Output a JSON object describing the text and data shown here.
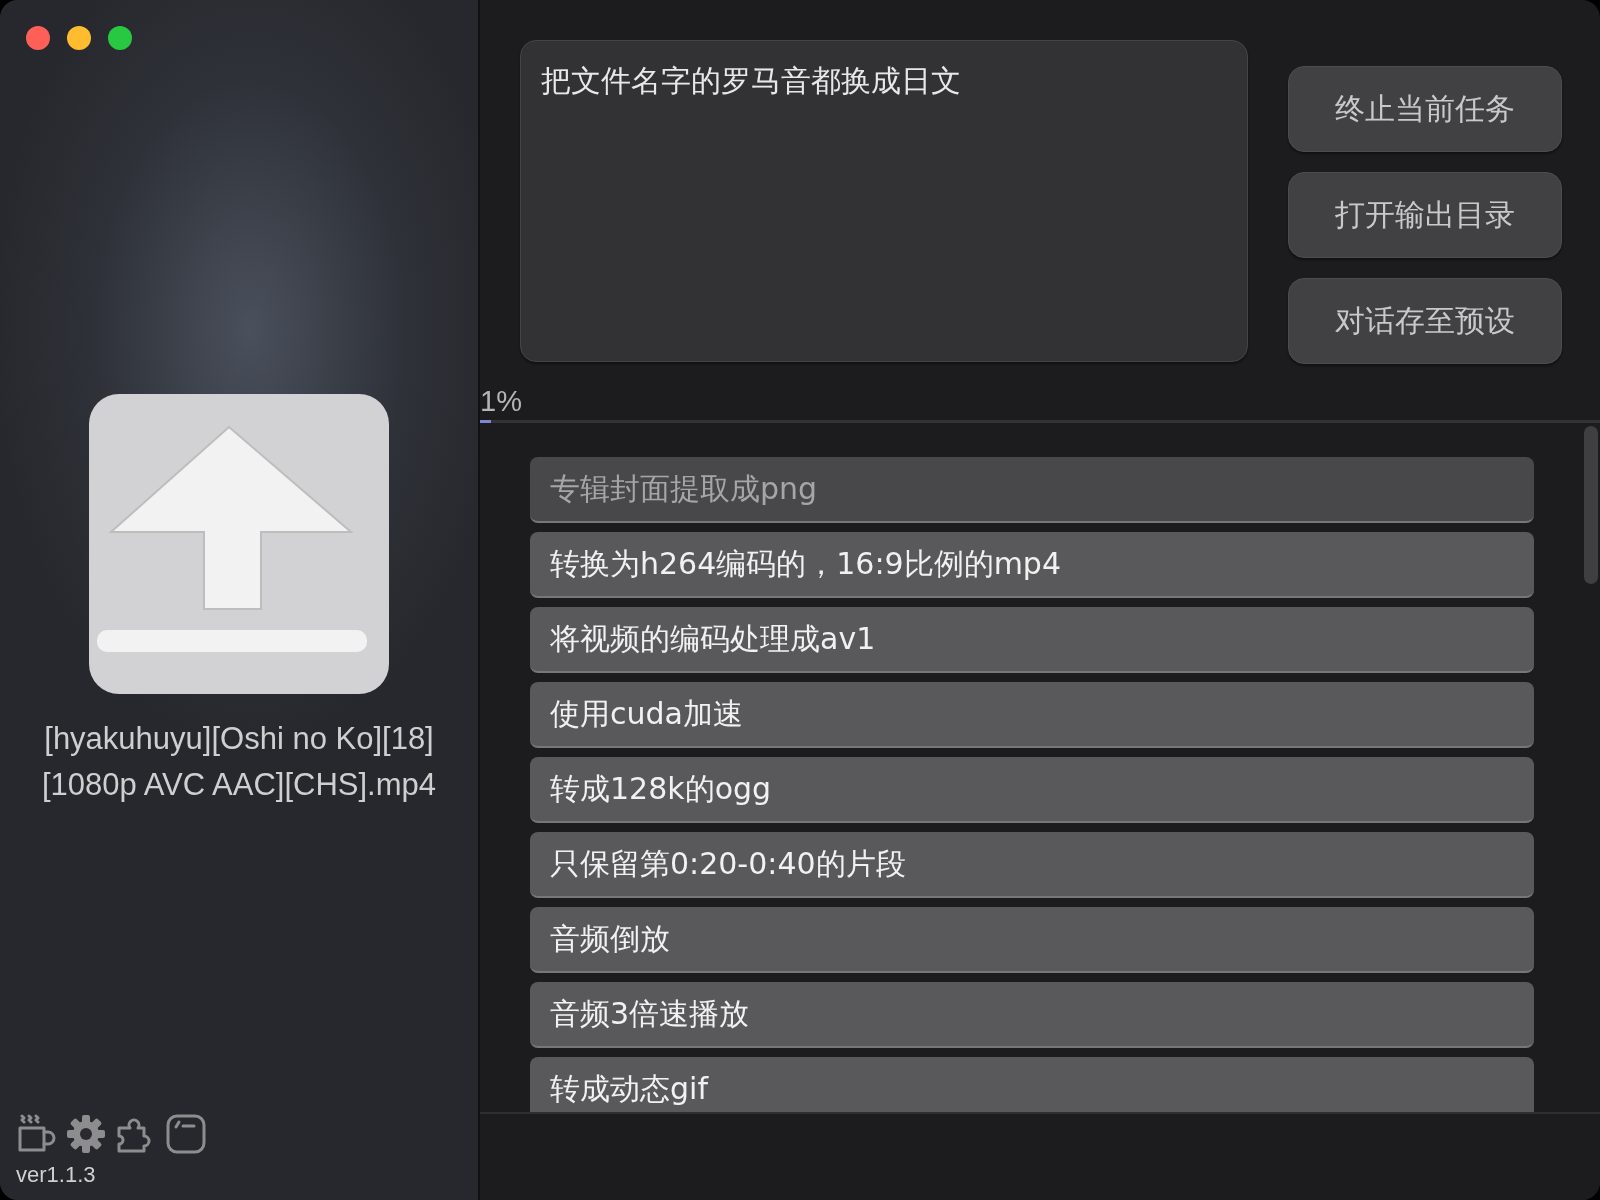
{
  "window": {
    "controls": [
      {
        "color": "#fe5f57"
      },
      {
        "color": "#febc2e"
      },
      {
        "color": "#28c840"
      }
    ]
  },
  "sidebar": {
    "file_name": "[hyakuhuyu][Oshi no Ko][18] [1080p AVC AAC][CHS].mp4",
    "tools": [
      {
        "kind": "coffee"
      },
      {
        "kind": "settings"
      },
      {
        "kind": "plugin"
      },
      {
        "kind": "terminal"
      }
    ],
    "version": "ver1.1.3"
  },
  "prompt": {
    "value": "把文件名字的罗马音都换成日文"
  },
  "buttons": [
    "终止当前任务",
    "打开输出目录",
    "对话存至预设"
  ],
  "progress": {
    "reading": "1%",
    "level": 0.01
  },
  "presets": [
    {
      "label": "专辑封面提取成png",
      "dimmed": true
    },
    {
      "label": "转换为h264编码的，16:9比例的mp4",
      "dimmed": false
    },
    {
      "label": "将视频的编码处理成av1",
      "dimmed": false
    },
    {
      "label": "使用cuda加速",
      "dimmed": false
    },
    {
      "label": "转成128k的ogg",
      "dimmed": false
    },
    {
      "label": "只保留第0:20-0:40的片段",
      "dimmed": false
    },
    {
      "label": "音频倒放",
      "dimmed": false
    },
    {
      "label": "音频3倍速播放",
      "dimmed": false
    },
    {
      "label": "转成动态gif",
      "dimmed": false
    }
  ]
}
